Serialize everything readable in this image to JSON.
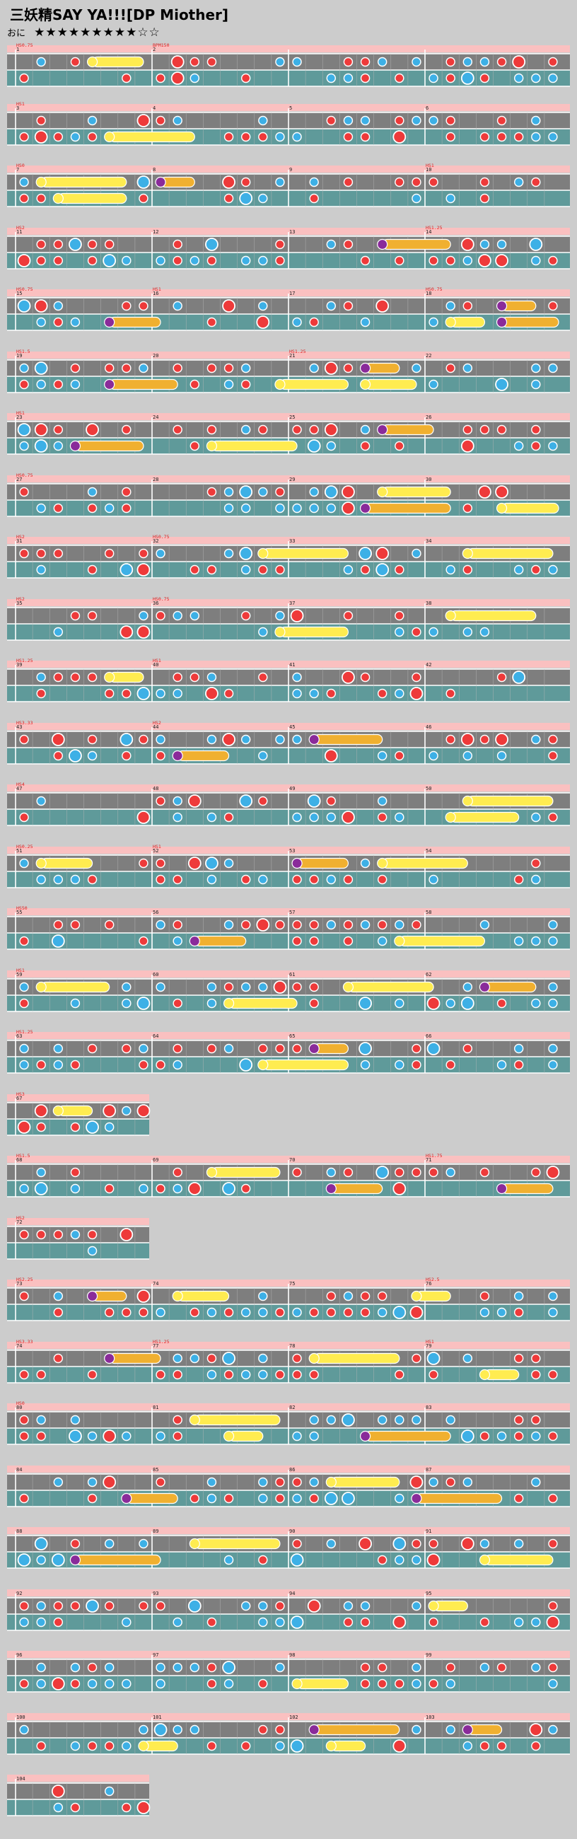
{
  "title": "三妖精SAY YA!!![DP Miother]",
  "difficulty": {
    "label": "おに",
    "stars": "★★★★★★★★★☆☆"
  },
  "colors": {
    "background": "#cccccc",
    "lane_teal": "#5f9a9a",
    "lane_gray": "#7e7e7e",
    "bar_line": "#ffffff",
    "pink_band": "#ffbfbf",
    "don": "#ee3a3a",
    "ka": "#3db0e6",
    "drumroll": "#f0b030",
    "balloon": "#ffec50",
    "marker_text": "#dd2222"
  },
  "icons": {
    "note": "drum-note-circle",
    "roll_head": "drumroll-head-icon",
    "balloon": "balloon-body"
  },
  "chart_data": {
    "type": "taiko-notation",
    "markers": [
      "HS0.75",
      "BPM150",
      "HS1",
      "HS0",
      "HS1",
      "HS2",
      "HS1.25",
      "HS0.75",
      "HS1",
      "HS0.75",
      "HS1.5",
      "HS1.25",
      "HS1",
      "HS0.75",
      "HS2",
      "HS0.75",
      "HS2",
      "HS0.75",
      "HS1.25",
      "HS1",
      "HS3.33",
      "HS2",
      "HS4",
      "HS0.25",
      "HS1",
      "HS50",
      "HS1",
      "HS1.25",
      "HS3",
      "HS1.5",
      "HS1.75",
      "HS2",
      "HS2.25",
      "HS2.5",
      "HS3.33",
      "HS1.25",
      "HS1",
      "HS0"
    ],
    "measure_labels": [
      "1",
      "2",
      "3",
      "4",
      "5",
      "6",
      "7",
      "8",
      "9",
      "10",
      "11",
      "12",
      "13",
      "14",
      "15",
      "16",
      "17",
      "18",
      "19",
      "20",
      "21",
      "22",
      "23",
      "24",
      "25",
      "26",
      "27",
      "28",
      "29",
      "30",
      "31",
      "32",
      "33",
      "34",
      "35",
      "36",
      "37",
      "38",
      "39",
      "40",
      "41",
      "42",
      "43",
      "44",
      "45",
      "46",
      "47",
      "48",
      "49",
      "50",
      "51",
      "52",
      "53",
      "54",
      "55",
      "56",
      "57",
      "58",
      "59",
      "60",
      "61",
      "62",
      "63",
      "64",
      "65",
      "66",
      "67",
      "68",
      "69",
      "70",
      "71",
      "72",
      "73",
      "74",
      "75",
      "76",
      "77",
      "78",
      "79",
      "80",
      "81",
      "82",
      "83",
      "84",
      "85",
      "86",
      "87",
      "88",
      "89",
      "90",
      "91",
      "92",
      "93",
      "94",
      "95",
      "96",
      "97",
      "98",
      "99",
      "100",
      "101",
      "102",
      "103",
      "104"
    ]
  }
}
